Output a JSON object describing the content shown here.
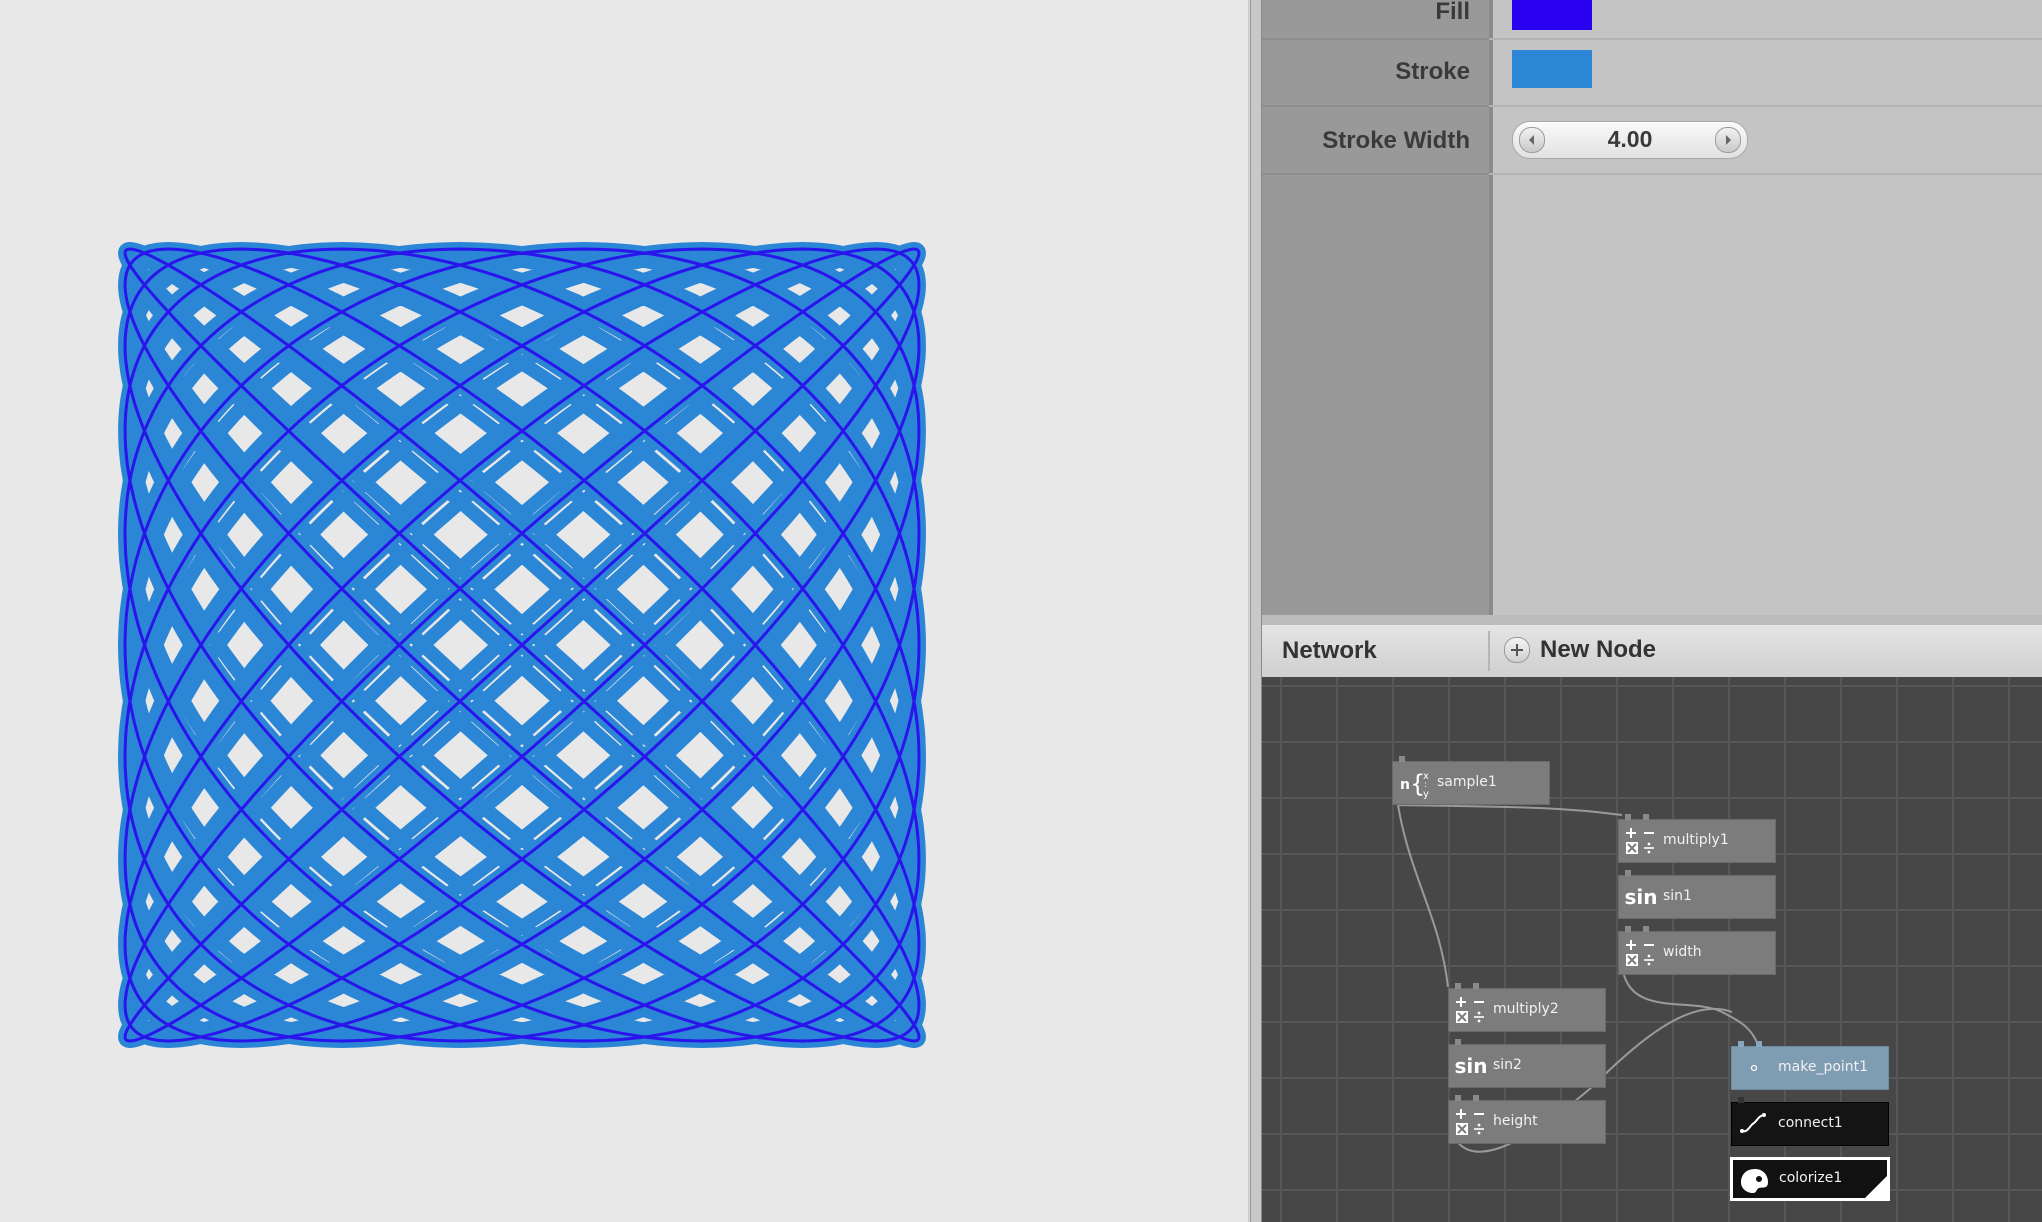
{
  "inspector": {
    "fill": {
      "label": "Fill",
      "color": "#2a00f0"
    },
    "stroke": {
      "label": "Stroke",
      "color": "#2b86d6"
    },
    "stroke_width": {
      "label": "Stroke Width",
      "value": "4.00"
    }
  },
  "network": {
    "title": "Network",
    "new_node_label": "New Node",
    "nodes": {
      "sample1": "sample1",
      "multiply1": "multiply1",
      "sin1": "sin1",
      "width": "width",
      "multiply2": "multiply2",
      "sin2": "sin2",
      "height": "height",
      "make_point1": "make_point1",
      "connect1": "connect1",
      "colorize1": "colorize1"
    },
    "sin_icon_text": "sin",
    "sample_icon_text": "n"
  },
  "viewer": {
    "figure": "lissajous-grid",
    "primary_color": "#2b86d6",
    "accent_color": "#2a00f0"
  }
}
